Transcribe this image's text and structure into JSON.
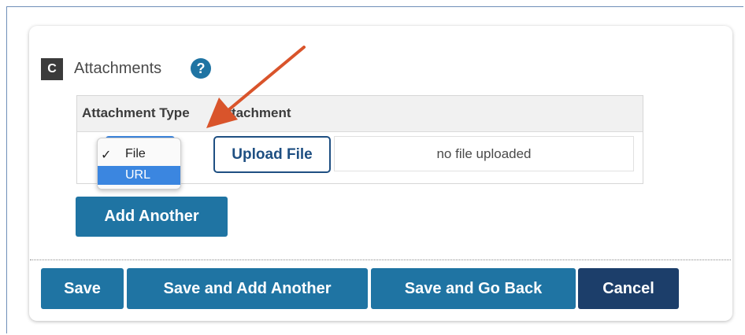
{
  "section": {
    "letter": "C",
    "title": "Attachments",
    "help_icon": "question-circle-icon"
  },
  "table": {
    "columns": [
      "Attachment Type",
      "Attachment"
    ],
    "row": {
      "type_dropdown": {
        "options": [
          {
            "label": "File",
            "checked": true
          },
          {
            "label": "URL",
            "highlighted": true
          }
        ]
      },
      "upload_label": "Upload File",
      "file_status": "no file uploaded"
    }
  },
  "buttons": {
    "add_another": "Add Another",
    "save": "Save",
    "save_and_add_another": "Save and Add Another",
    "save_and_go_back": "Save and Go Back",
    "cancel": "Cancel"
  },
  "icons": {
    "check": "✓"
  },
  "colors": {
    "primary_button": "#1f74a3",
    "cancel_button": "#1c3e6a",
    "dropdown_highlight": "#3b86e0",
    "annotation_arrow": "#d9542b"
  }
}
